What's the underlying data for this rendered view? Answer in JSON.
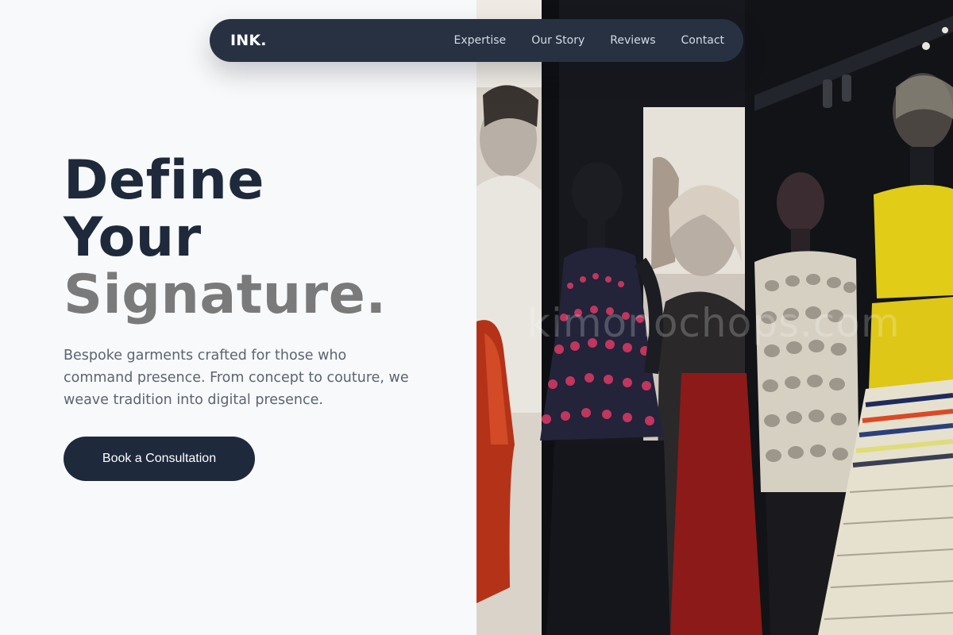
{
  "nav": {
    "logo": "INK.",
    "links": [
      "Expertise",
      "Our Story",
      "Reviews",
      "Contact"
    ]
  },
  "hero": {
    "title_line1": "Define",
    "title_line2": "Your",
    "title_line3": "Signature.",
    "description": "Bespoke garments crafted for those who command presence. From concept to couture, we weave tradition into digital presence.",
    "cta_label": "Book a Consultation"
  },
  "image": {
    "subject": "couture exhibition with mannequins",
    "watermark": "kimonochops.com"
  },
  "colors": {
    "nav_bg": "#273142",
    "title_dark": "#1e293b",
    "title_grey": "#7a7a7a",
    "body_text": "#5b6473",
    "page_bg": "#f8f9fa"
  }
}
